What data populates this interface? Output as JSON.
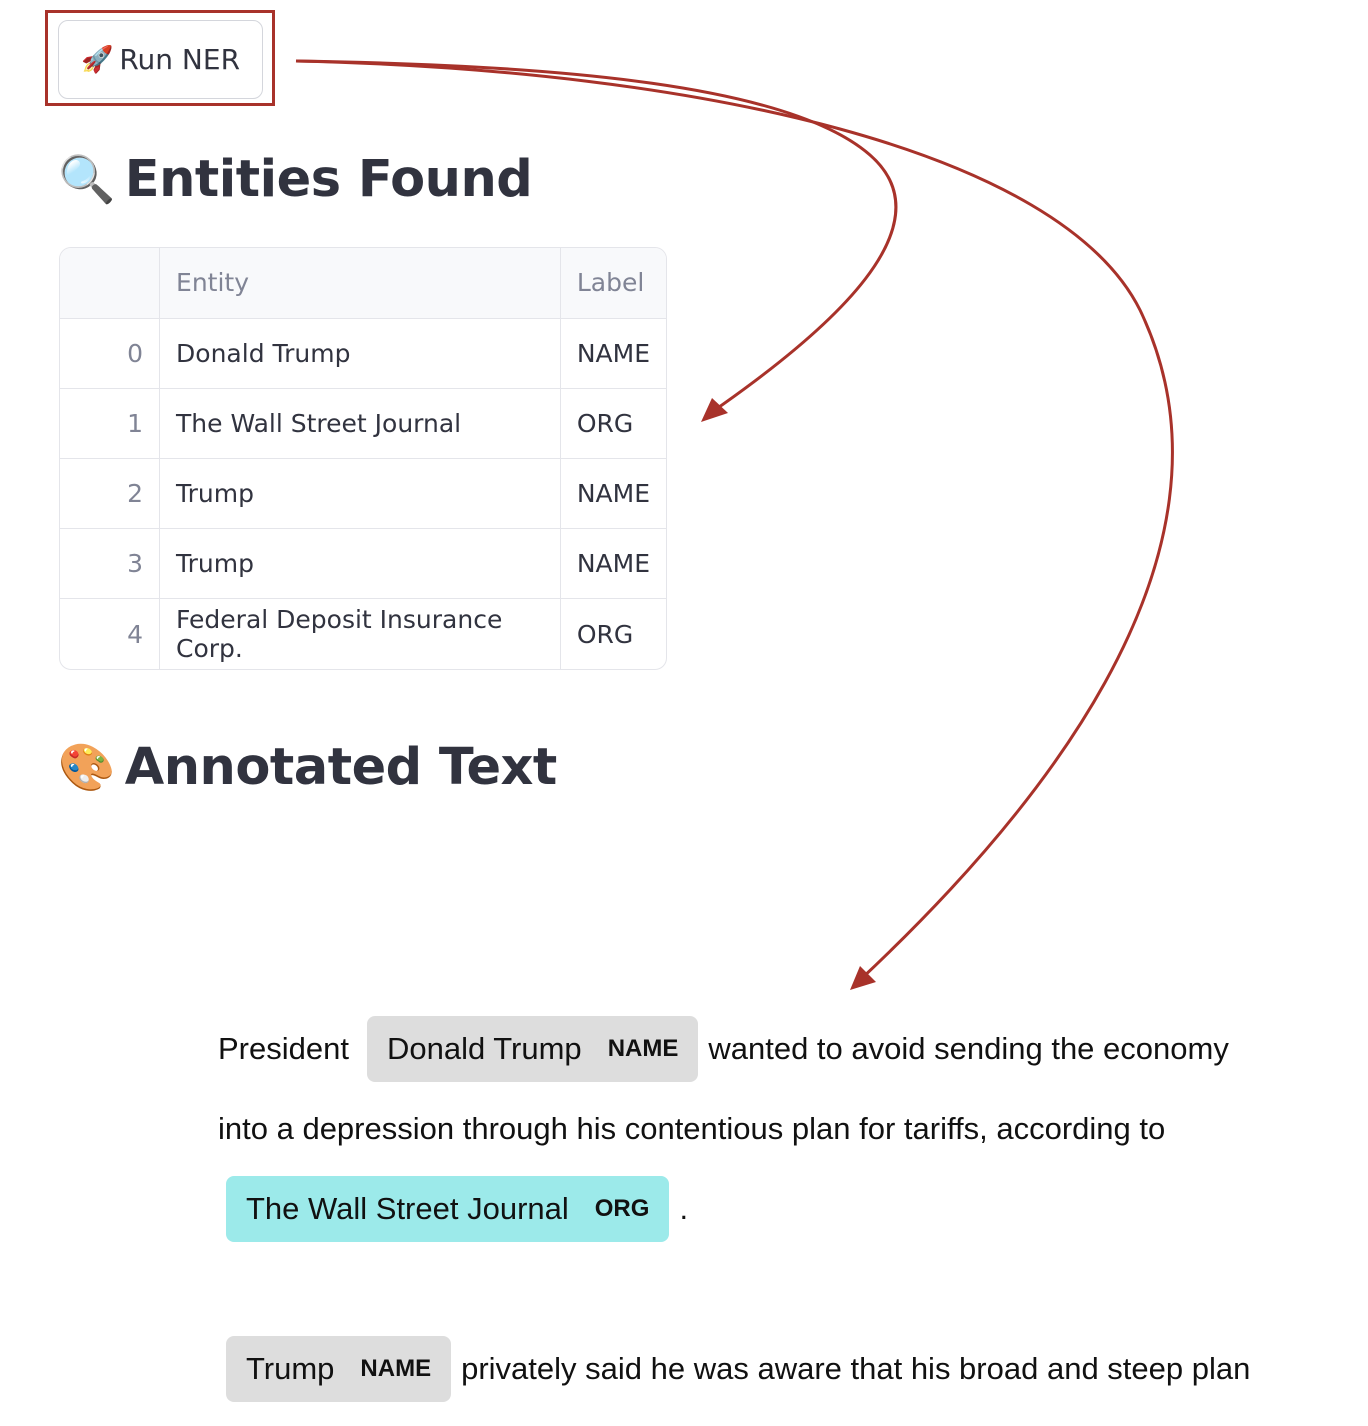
{
  "run_button": {
    "label": "Run NER",
    "icon": "rocket-icon",
    "glyph": "🚀"
  },
  "entities_section": {
    "title": "Entities Found",
    "icon": "magnifier-icon",
    "glyph": "🔍"
  },
  "table": {
    "columns": [
      "",
      "Entity",
      "Label"
    ],
    "rows": [
      {
        "index": "0",
        "entity": "Donald Trump",
        "label": "NAME"
      },
      {
        "index": "1",
        "entity": "The Wall Street Journal",
        "label": "ORG"
      },
      {
        "index": "2",
        "entity": "Trump",
        "label": "NAME"
      },
      {
        "index": "3",
        "entity": "Trump",
        "label": "NAME"
      },
      {
        "index": "4",
        "entity": "Federal Deposit Insurance Corp.",
        "label": "ORG"
      }
    ]
  },
  "annotated_section": {
    "title": "Annotated Text",
    "icon": "palette-icon",
    "glyph": "🎨"
  },
  "annotated_text": {
    "line1": {
      "before": "President",
      "entity": "Donald Trump",
      "label": "NAME",
      "after": "wanted to avoid sending the economy"
    },
    "line2": {
      "text": "into a depression through his contentious plan for tariffs, according to"
    },
    "line3": {
      "entity": "The Wall Street Journal",
      "label": "ORG",
      "after": "."
    },
    "line4": {
      "entity": "Trump",
      "label": "NAME",
      "after": "privately said he was aware that his broad and steep plan"
    }
  },
  "colors": {
    "highlight_frame": "#a8322a",
    "arrow": "#a8322a",
    "name_entity_bg": "#dddddd",
    "org_entity_bg": "#9ceaea"
  }
}
